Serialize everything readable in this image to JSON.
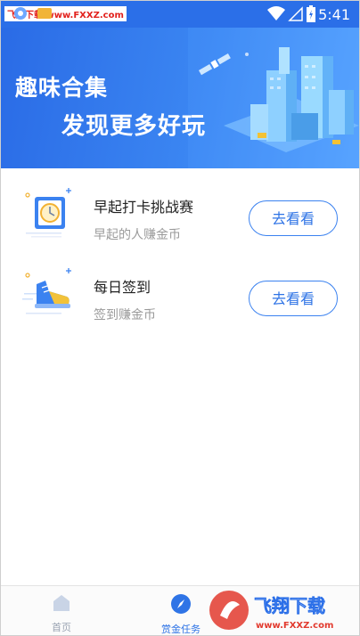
{
  "status_bar": {
    "time": "5:41",
    "watermark": "飞翔下载 www.FXXZ.com"
  },
  "banner": {
    "title": "趣味合集",
    "subtitle": "发现更多好玩"
  },
  "tasks": [
    {
      "title": "早起打卡挑战赛",
      "desc": "早起的人赚金币",
      "button": "去看看",
      "icon": "clock-icon"
    },
    {
      "title": "每日签到",
      "desc": "签到赚金币",
      "button": "去看看",
      "icon": "sneaker-icon"
    }
  ],
  "bottom_nav": {
    "items": [
      {
        "label": "首页",
        "icon": "home-icon",
        "active": false
      },
      {
        "label": "赏金任务",
        "icon": "compass-icon",
        "active": true
      }
    ]
  },
  "watermark": {
    "text": "飞翔下载",
    "url": "www.FXXZ.com"
  },
  "colors": {
    "primary": "#2b6fe8",
    "accent": "#3b82f0"
  }
}
